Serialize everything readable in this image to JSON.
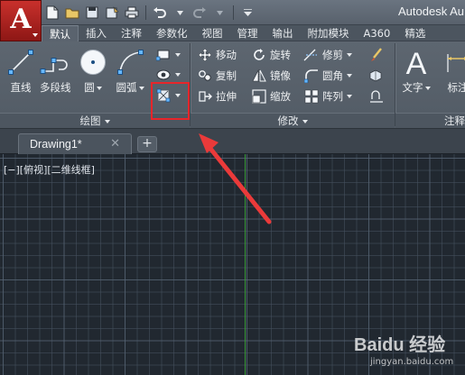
{
  "title_bar": {
    "app_title": "Autodesk Au",
    "app_button_letter": "A"
  },
  "ribbon_tabs": [
    {
      "label": "默认",
      "active": true
    },
    {
      "label": "插入",
      "active": false
    },
    {
      "label": "注释",
      "active": false
    },
    {
      "label": "参数化",
      "active": false
    },
    {
      "label": "视图",
      "active": false
    },
    {
      "label": "管理",
      "active": false
    },
    {
      "label": "输出",
      "active": false
    },
    {
      "label": "附加模块",
      "active": false
    },
    {
      "label": "A360",
      "active": false
    },
    {
      "label": "精选",
      "active": false
    }
  ],
  "draw_panel": {
    "title": "绘图",
    "tools": {
      "line": "直线",
      "polyline": "多段线",
      "circle": "圆",
      "arc": "圆弧"
    }
  },
  "modify_panel": {
    "title": "修改",
    "tools": {
      "move": "移动",
      "rotate": "旋转",
      "trim": "修剪",
      "copy": "复制",
      "mirror": "镜像",
      "fillet": "圆角",
      "stretch": "拉伸",
      "scale": "缩放",
      "array": "阵列"
    }
  },
  "annotation_panel": {
    "title": "注释",
    "tools": {
      "text": "文字",
      "dimension": "标注"
    }
  },
  "file_tab": {
    "name": "Drawing1*",
    "close_glyph": "✕",
    "new_tab_glyph": "+"
  },
  "viewport": {
    "label": "[−][俯视][二维线框]"
  },
  "watermark": {
    "brand": "Baidu 经验",
    "site": "jingyan.baidu.com"
  },
  "colors": {
    "highlight": "#e8252a",
    "y_axis": "#3a9a3a",
    "app_button": "#c8302c"
  }
}
